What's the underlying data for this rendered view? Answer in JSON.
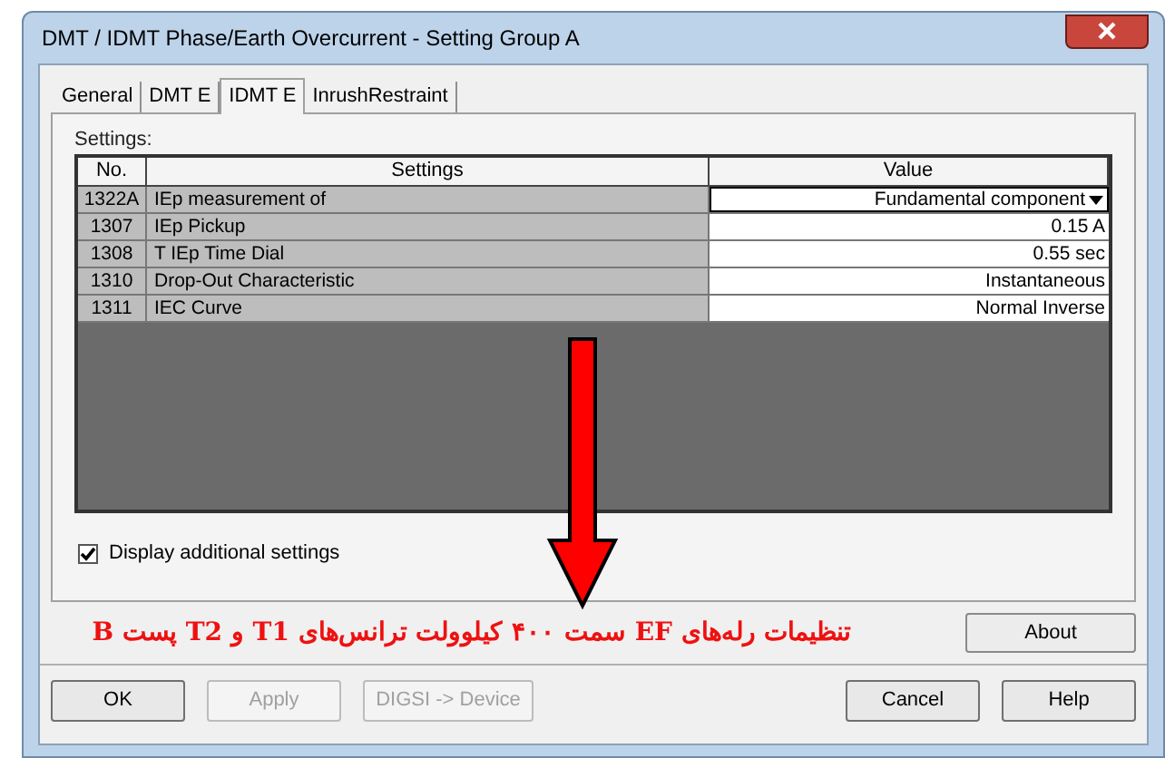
{
  "window": {
    "title": "DMT / IDMT Phase/Earth Overcurrent - Setting Group A"
  },
  "tabs": [
    {
      "label": "General",
      "selected": false
    },
    {
      "label": "DMT E",
      "selected": false
    },
    {
      "label": "IDMT E",
      "selected": true
    },
    {
      "label": "InrushRestraint",
      "selected": false
    }
  ],
  "settings_label": "Settings:",
  "table": {
    "columns": [
      "No.",
      "Settings",
      "Value"
    ],
    "rows": [
      {
        "no": "1322A",
        "setting": "IEp measurement of",
        "value": "Fundamental component",
        "kind": "dropdown"
      },
      {
        "no": "1307",
        "setting": "IEp Pickup",
        "value": "0.15 A",
        "kind": "text"
      },
      {
        "no": "1308",
        "setting": "T IEp Time Dial",
        "value": "0.55 sec",
        "kind": "text"
      },
      {
        "no": "1310",
        "setting": "Drop-Out Characteristic",
        "value": "Instantaneous",
        "kind": "text"
      },
      {
        "no": "1311",
        "setting": "IEC Curve",
        "value": "Normal Inverse",
        "kind": "text"
      }
    ]
  },
  "display_additional": {
    "label": "Display additional settings",
    "checked": true
  },
  "annotation": "تنظیمات رله‌های EF سمت ۴۰۰ کیلوولت ترانس‌های T1 و T2 پست B",
  "about_button": "About",
  "left_buttons": [
    {
      "label": "OK",
      "disabled": false
    },
    {
      "label": "Apply",
      "disabled": true
    },
    {
      "label": "DIGSI -> Device",
      "disabled": true
    }
  ],
  "right_buttons": [
    {
      "label": "Cancel",
      "disabled": false
    },
    {
      "label": "Help",
      "disabled": false
    }
  ]
}
